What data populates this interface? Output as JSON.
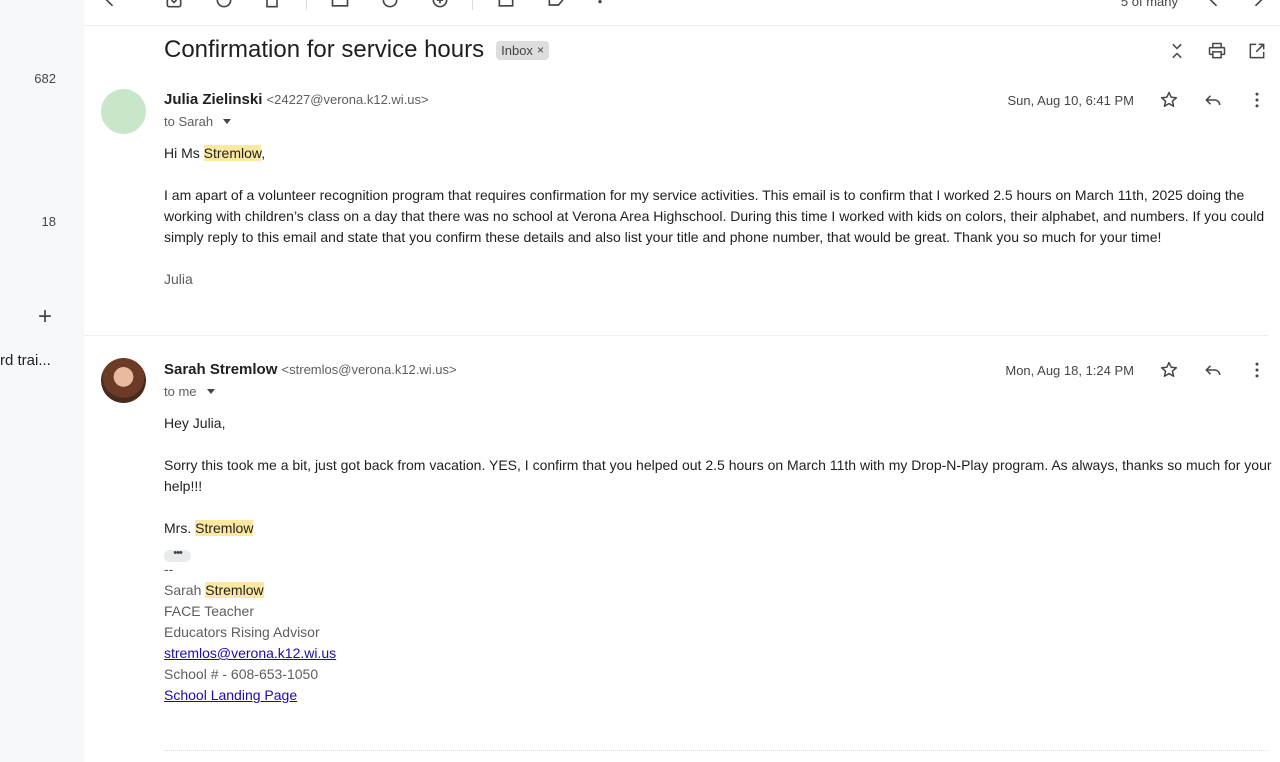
{
  "left_rail": {
    "count_1": "682",
    "count_2": "18",
    "plus": "+",
    "label_partial": "rd trai..."
  },
  "toolbar": {
    "count_text": "5 of many"
  },
  "thread": {
    "subject": "Confirmation for service hours",
    "label_chip": "Inbox",
    "label_remove": "×"
  },
  "message1": {
    "sender_name": "Julia Zielinski",
    "sender_email": "<24227@verona.k12.wi.us>",
    "to": "to Sarah",
    "date": "Sun, Aug 10, 6:41 PM",
    "greeting_prefix": "Hi Ms ",
    "greeting_highlight": "Stremlow",
    "greeting_suffix": ",",
    "body": "I am apart of a volunteer recognition program that requires confirmation for my service activities. This email is to confirm that I worked 2.5 hours on March 11th, 2025 doing the working with children’s class on a day that there was no school at Verona Area Highschool. During this time I worked with kids on colors, their alphabet, and numbers. If you could simply reply to this email and state that you confirm these details and also list your title and phone number, that would be great. Thank you so much for your time!",
    "signoff": "Julia"
  },
  "message2": {
    "sender_name": "Sarah Stremlow",
    "sender_email": "<stremlos@verona.k12.wi.us>",
    "to": "to me",
    "date": "Mon, Aug 18, 1:24 PM",
    "greeting": "Hey Julia,",
    "body": "Sorry this took me a bit, just got back from vacation.  YES, I confirm that you helped out 2.5 hours on March 11th with my Drop-N-Play program.  As always, thanks so much for your help!!!",
    "signoff_prefix": "Mrs. ",
    "signoff_highlight": "Stremlow",
    "ellipsis": "•••",
    "sig_dash": "--",
    "sig_first": "Sarah ",
    "sig_last_highlight": "Stremlow",
    "sig_title": "FACE Teacher",
    "sig_role": "Educators Rising Advisor",
    "sig_email": "stremlos@verona.k12.wi.us",
    "sig_phone": "School # - 608-653-1050",
    "sig_link": "School Landing Page"
  }
}
